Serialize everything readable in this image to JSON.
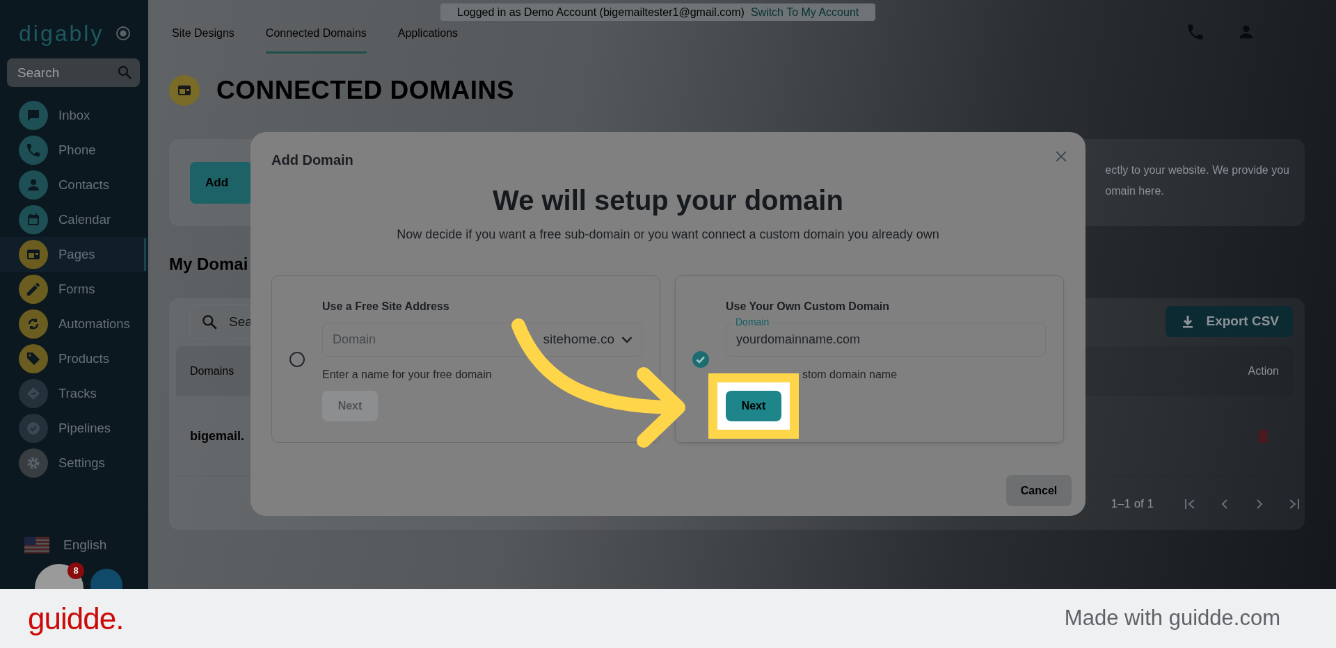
{
  "sidebar": {
    "logo": "digably",
    "search": {
      "placeholder": "Search"
    },
    "items": [
      {
        "label": "Inbox",
        "color": "#1d4f54",
        "selected": false
      },
      {
        "label": "Phone",
        "color": "#1d4f54",
        "selected": false
      },
      {
        "label": "Contacts",
        "color": "#1d4f54",
        "selected": false
      },
      {
        "label": "Calendar",
        "color": "#1d4f54",
        "selected": false
      },
      {
        "label": "Pages",
        "color": "#6b5c1f",
        "selected": true
      },
      {
        "label": "Forms",
        "color": "#6b5c1f",
        "selected": false
      },
      {
        "label": "Automations",
        "color": "#6b5c1f",
        "selected": false
      },
      {
        "label": "Products",
        "color": "#6b5c1f",
        "selected": false
      },
      {
        "label": "Tracks",
        "color": "#24313a",
        "selected": false
      },
      {
        "label": "Pipelines",
        "color": "#24313a",
        "selected": false
      },
      {
        "label": "Settings",
        "color": "#383d42",
        "selected": false
      }
    ],
    "language": "English",
    "notification_count": "8"
  },
  "top_bar": {
    "login_notice": "Logged in as Demo Account (bigemailtester1@gmail.com)",
    "switch_link": "Switch To My Account",
    "tabs": [
      {
        "label": "Site Designs",
        "selected": false
      },
      {
        "label": "Connected Domains",
        "selected": true
      },
      {
        "label": "Applications",
        "selected": false
      }
    ]
  },
  "page": {
    "title": "CONNECTED DOMAINS",
    "add_button": "Add",
    "intro_lines": [
      "ectly to your website. We provide you",
      "omain here."
    ],
    "section_title": "My Domai",
    "search": {
      "placeholder": "Sea"
    },
    "export_button": "Export CSV",
    "columns": [
      "Domains",
      "Action"
    ],
    "rows": [
      {
        "domain": "bigemail."
      }
    ],
    "pagination": "1–1 of 1"
  },
  "modal": {
    "title": "Add Domain",
    "heading": "We will setup your domain",
    "subtitle": "Now decide if you want a free sub-domain or you want connect a custom domain you already own",
    "options": [
      {
        "kind": "subdomain",
        "title": "Use a Free Site Address",
        "selected": false,
        "field": {
          "placeholder": "Domain"
        },
        "suffix": "sitehome.co",
        "help": "Enter a name for your free domain",
        "next": {
          "label": "Next",
          "disabled": true,
          "highlighted": false
        }
      },
      {
        "kind": "custom",
        "title": "Use Your Own Custom Domain",
        "selected": true,
        "field": {
          "label": "Domain",
          "value": "yourdomainname.com"
        },
        "help": "stom domain name",
        "next": {
          "label": "Next",
          "disabled": false,
          "highlighted": true
        }
      }
    ],
    "cancel_button": "Cancel"
  },
  "footer": {
    "brand": "guidde.",
    "credit": "Made with guidde.com"
  }
}
